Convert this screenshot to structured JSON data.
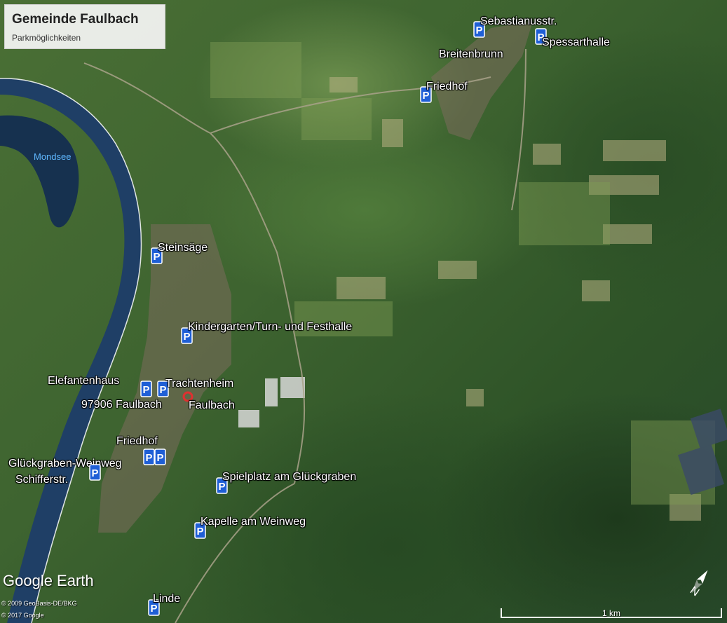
{
  "title_box": {
    "title": "Gemeinde Faulbach",
    "subtitle": "Parkmöglichkeiten"
  },
  "parking_labels": {
    "sebastianusstr": "Sebastianusstr.",
    "spessarthalle": "Spessarthalle",
    "breitenbrunn": "Breitenbrunn",
    "friedhof_breitenbrunn": "Friedhof",
    "steinsaege": "Steinsäge",
    "kindergarten": "Kindergarten/Turn- und Festhalle",
    "elefantenhaus": "Elefantenhaus",
    "trachtenheim": "Trachtenheim",
    "address": "97906 Faulbach",
    "faulbach": "Faulbach",
    "friedhof_faulbach": "Friedhof",
    "glueckgraben_weinweg": "Glückgraben-Weinweg",
    "schifferstr": "Schifferstr.",
    "spielplatz": "Spielplatz am Glückgraben",
    "kapelle": "Kapelle am Weinweg",
    "linde": "Linde"
  },
  "water_label": "Mondsee",
  "branding": {
    "logo": "Google Earth",
    "credit_1": "© 2009 GeoBasis-DE/BKG",
    "credit_2": "© 2017 Google"
  },
  "scale_bar": {
    "label": "1 km"
  },
  "colors": {
    "pin_blue": "#1f5fd6",
    "river": "#1f3f66",
    "road": "#a9a28a",
    "field_light": "#b9b48a"
  },
  "icons": {
    "parking": "parking-pin-icon",
    "location": "location-pin-icon",
    "compass": "compass-icon"
  }
}
